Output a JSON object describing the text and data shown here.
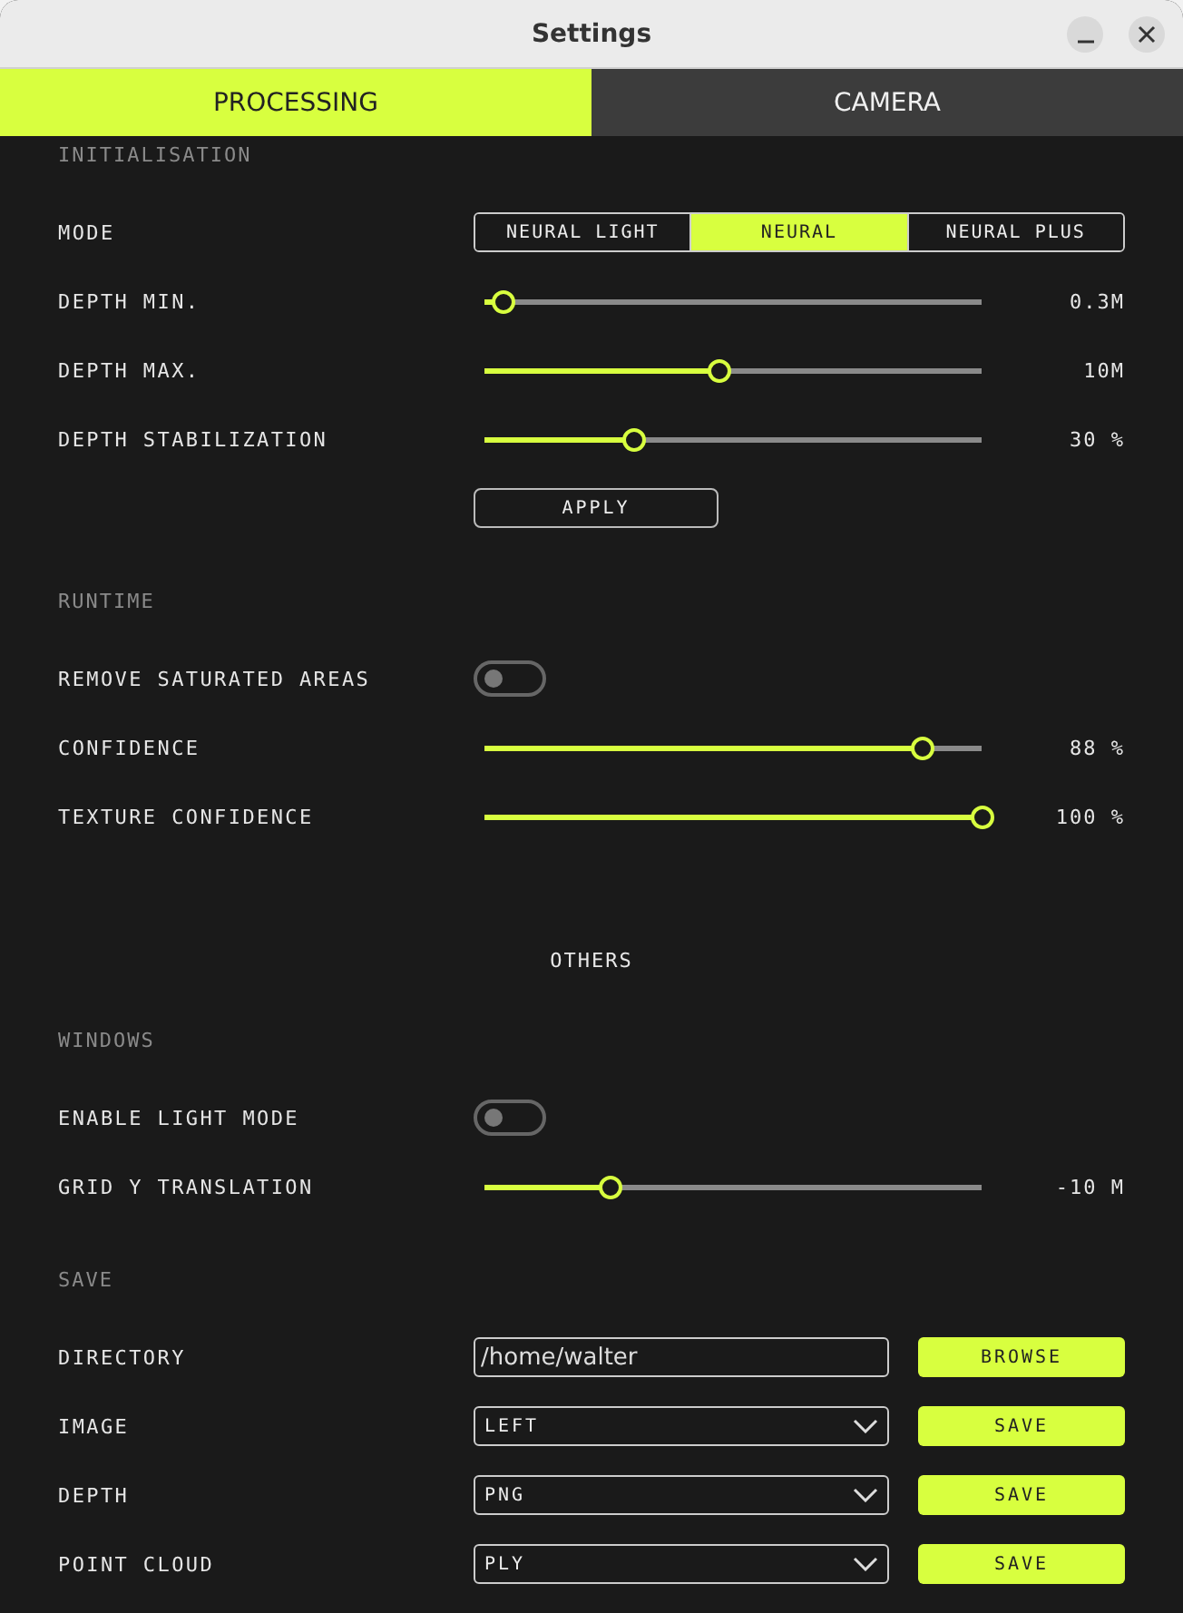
{
  "window": {
    "title": "Settings"
  },
  "tabs": [
    {
      "label": "PROCESSING",
      "selected": true
    },
    {
      "label": "CAMERA",
      "selected": false
    }
  ],
  "blocks": [
    {
      "kind": "group",
      "title": "INITIALISATION",
      "rows": [
        {
          "kind": "segmented",
          "label": "MODE",
          "options": [
            {
              "label": "NEURAL LIGHT",
              "selected": false
            },
            {
              "label": "NEURAL",
              "selected": true
            },
            {
              "label": "NEURAL PLUS",
              "selected": false
            }
          ]
        },
        {
          "kind": "slider",
          "label": "DEPTH MIN.",
          "level": 0.036,
          "reading": "0.3M"
        },
        {
          "kind": "slider",
          "label": "DEPTH MAX.",
          "level": 0.47,
          "reading": "10M"
        },
        {
          "kind": "slider",
          "label": "DEPTH STABILIZATION",
          "level": 0.3,
          "reading": "30 %"
        },
        {
          "kind": "button",
          "label": "APPLY"
        }
      ]
    },
    {
      "kind": "group",
      "title": "RUNTIME",
      "rows": [
        {
          "kind": "toggle",
          "label": "REMOVE SATURATED AREAS",
          "on": false
        },
        {
          "kind": "slider",
          "label": "CONFIDENCE",
          "level": 0.88,
          "reading": "88 %"
        },
        {
          "kind": "slider",
          "label": "TEXTURE CONFIDENCE",
          "level": 1.0,
          "reading": "100 %"
        }
      ]
    },
    {
      "kind": "heading",
      "text": "OTHERS"
    },
    {
      "kind": "group",
      "title": "WINDOWS",
      "rows": [
        {
          "kind": "toggle",
          "label": "ENABLE LIGHT MODE",
          "on": false
        },
        {
          "kind": "slider",
          "label": "GRID Y TRANSLATION",
          "level": 0.25,
          "reading": "-10 M"
        }
      ]
    },
    {
      "kind": "group",
      "title": "SAVE",
      "rows": [
        {
          "kind": "path",
          "label": "DIRECTORY",
          "value": "/home/walter",
          "button": "BROWSE"
        },
        {
          "kind": "select",
          "label": "IMAGE",
          "value": "LEFT",
          "button": "SAVE"
        },
        {
          "kind": "select",
          "label": "DEPTH",
          "value": "PNG",
          "button": "SAVE"
        },
        {
          "kind": "select",
          "label": "POINT CLOUD",
          "value": "PLY",
          "button": "SAVE"
        }
      ]
    }
  ]
}
